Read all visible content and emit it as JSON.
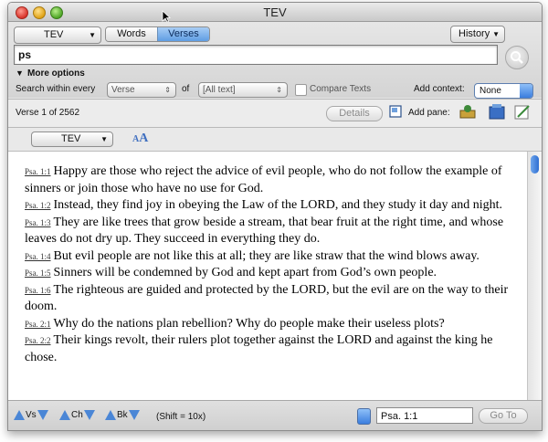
{
  "window": {
    "title": "TEV"
  },
  "toolbar": {
    "bible_select": "TEV",
    "mode_words": "Words",
    "mode_verses": "Verses",
    "history_label": "History",
    "search_value": "ps",
    "more_options": "More options",
    "search_within_label": "Search within every",
    "unit_select": "Verse",
    "of_label": "of",
    "range_select": "[All text]",
    "compare_texts": "Compare Texts",
    "add_context_label": "Add context:",
    "context_select": "None"
  },
  "infobar": {
    "verse_counter": "Verse 1  of 2562",
    "details_label": "Details",
    "add_pane_label": "Add pane:"
  },
  "pane": {
    "bible_select": "TEV",
    "font_size_icon": "AA"
  },
  "verses": [
    {
      "ref": "Psa. 1:1",
      "text": "Happy are those who reject the advice of evil people, who do not follow the example of sinners or join those who have no use for God."
    },
    {
      "ref": "Psa. 1:2",
      "text": "Instead, they find joy in obeying the Law of the LORD, and they study it day and night."
    },
    {
      "ref": "Psa. 1:3",
      "text": "They are like trees that grow beside a stream, that bear fruit at the right time, and whose leaves do not dry up. They succeed in everything they do."
    },
    {
      "ref": "Psa. 1:4",
      "text": "But evil people are not like this at all; they are like straw that the wind blows away."
    },
    {
      "ref": "Psa. 1:5",
      "text": "Sinners will be condemned by God and kept apart from God’s own people."
    },
    {
      "ref": "Psa. 1:6",
      "text": "The righteous are guided and protected by the LORD, but the evil are on the way to their doom."
    },
    {
      "ref": "Psa. 2:1",
      "text": "Why do the nations plan rebellion? Why do people make their useless plots?"
    },
    {
      "ref": "Psa. 2:2",
      "text": "Their kings revolt, their rulers plot together against the LORD and against the king he chose."
    }
  ],
  "bottom": {
    "vs": "Vs",
    "ch": "Ch",
    "bk": "Bk",
    "shift_hint": "(Shift = 10x)",
    "goto_ref": "Psa. 1:1",
    "goto_label": "Go To"
  },
  "colors": {
    "accent": "#4a86d6",
    "selected_segment": "#5f9de3"
  }
}
